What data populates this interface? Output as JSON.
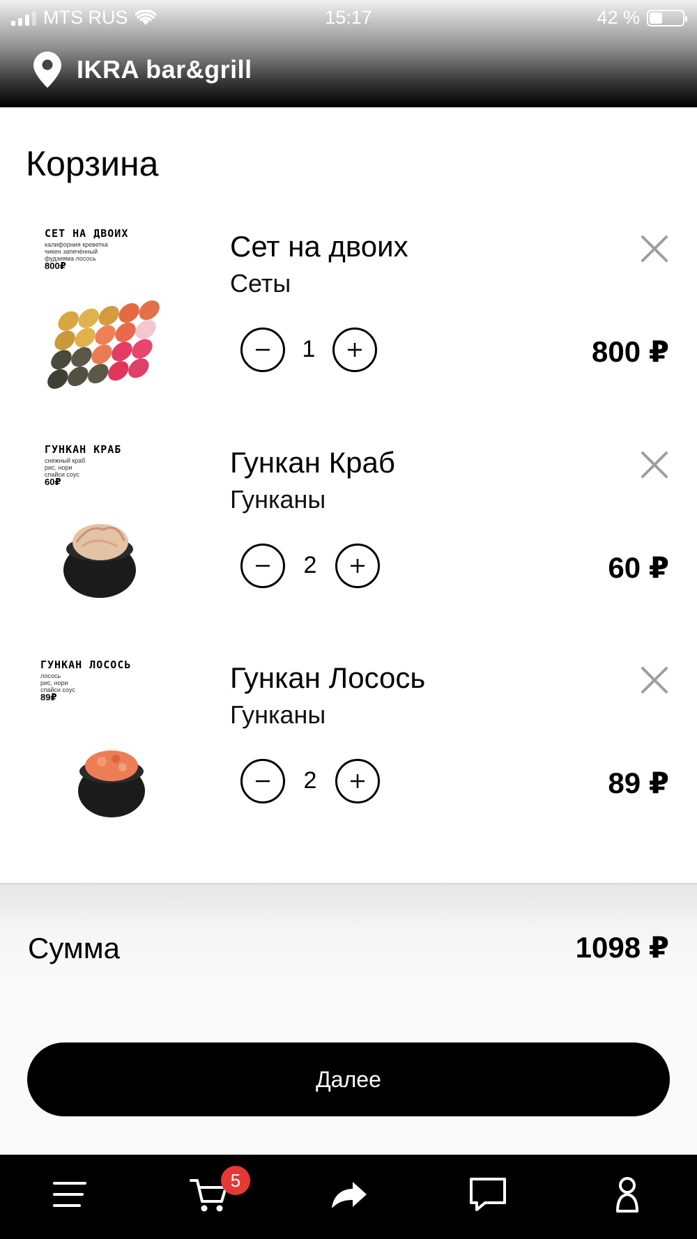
{
  "status_bar": {
    "carrier": "MTS RUS",
    "time": "15:17",
    "battery_percent": "42 %",
    "battery_level": 0.42
  },
  "header": {
    "venue_name": "IKRA bar&grill"
  },
  "page": {
    "title": "Корзина"
  },
  "cart": {
    "items": [
      {
        "name": "Сет на двоих",
        "category": "Сеты",
        "quantity": "1",
        "price": "800 ₽",
        "image_title": "СЕТ НА ДВОИХ",
        "image_desc": "калифорния креветка\nчикен запечённый\nфудзияма лосось",
        "image_price": "800₽"
      },
      {
        "name": "Гункан Краб",
        "category": "Гунканы",
        "quantity": "2",
        "price": "60 ₽",
        "image_title": "ГУНКАН КРАБ",
        "image_desc": "снежный краб\nрис, нори\nспайси соус",
        "image_price": "60₽"
      },
      {
        "name": "Гункан Лосось",
        "category": "Гунканы",
        "quantity": "2",
        "price": "89 ₽",
        "image_title": "ГУНКАН ЛОСОСЬ",
        "image_desc": "лосось\nрис, нори\nспайси соус",
        "image_price": "89₽"
      }
    ]
  },
  "summary": {
    "label": "Сумма",
    "total": "1098 ₽",
    "next_label": "Далее"
  },
  "tabbar": {
    "cart_badge": "5",
    "icons": [
      "menu-icon",
      "cart-icon",
      "share-icon",
      "chat-icon",
      "profile-icon"
    ]
  },
  "colors": {
    "accent": "#000000",
    "badge": "#e53935",
    "remove_icon": "#9e9e9e"
  }
}
